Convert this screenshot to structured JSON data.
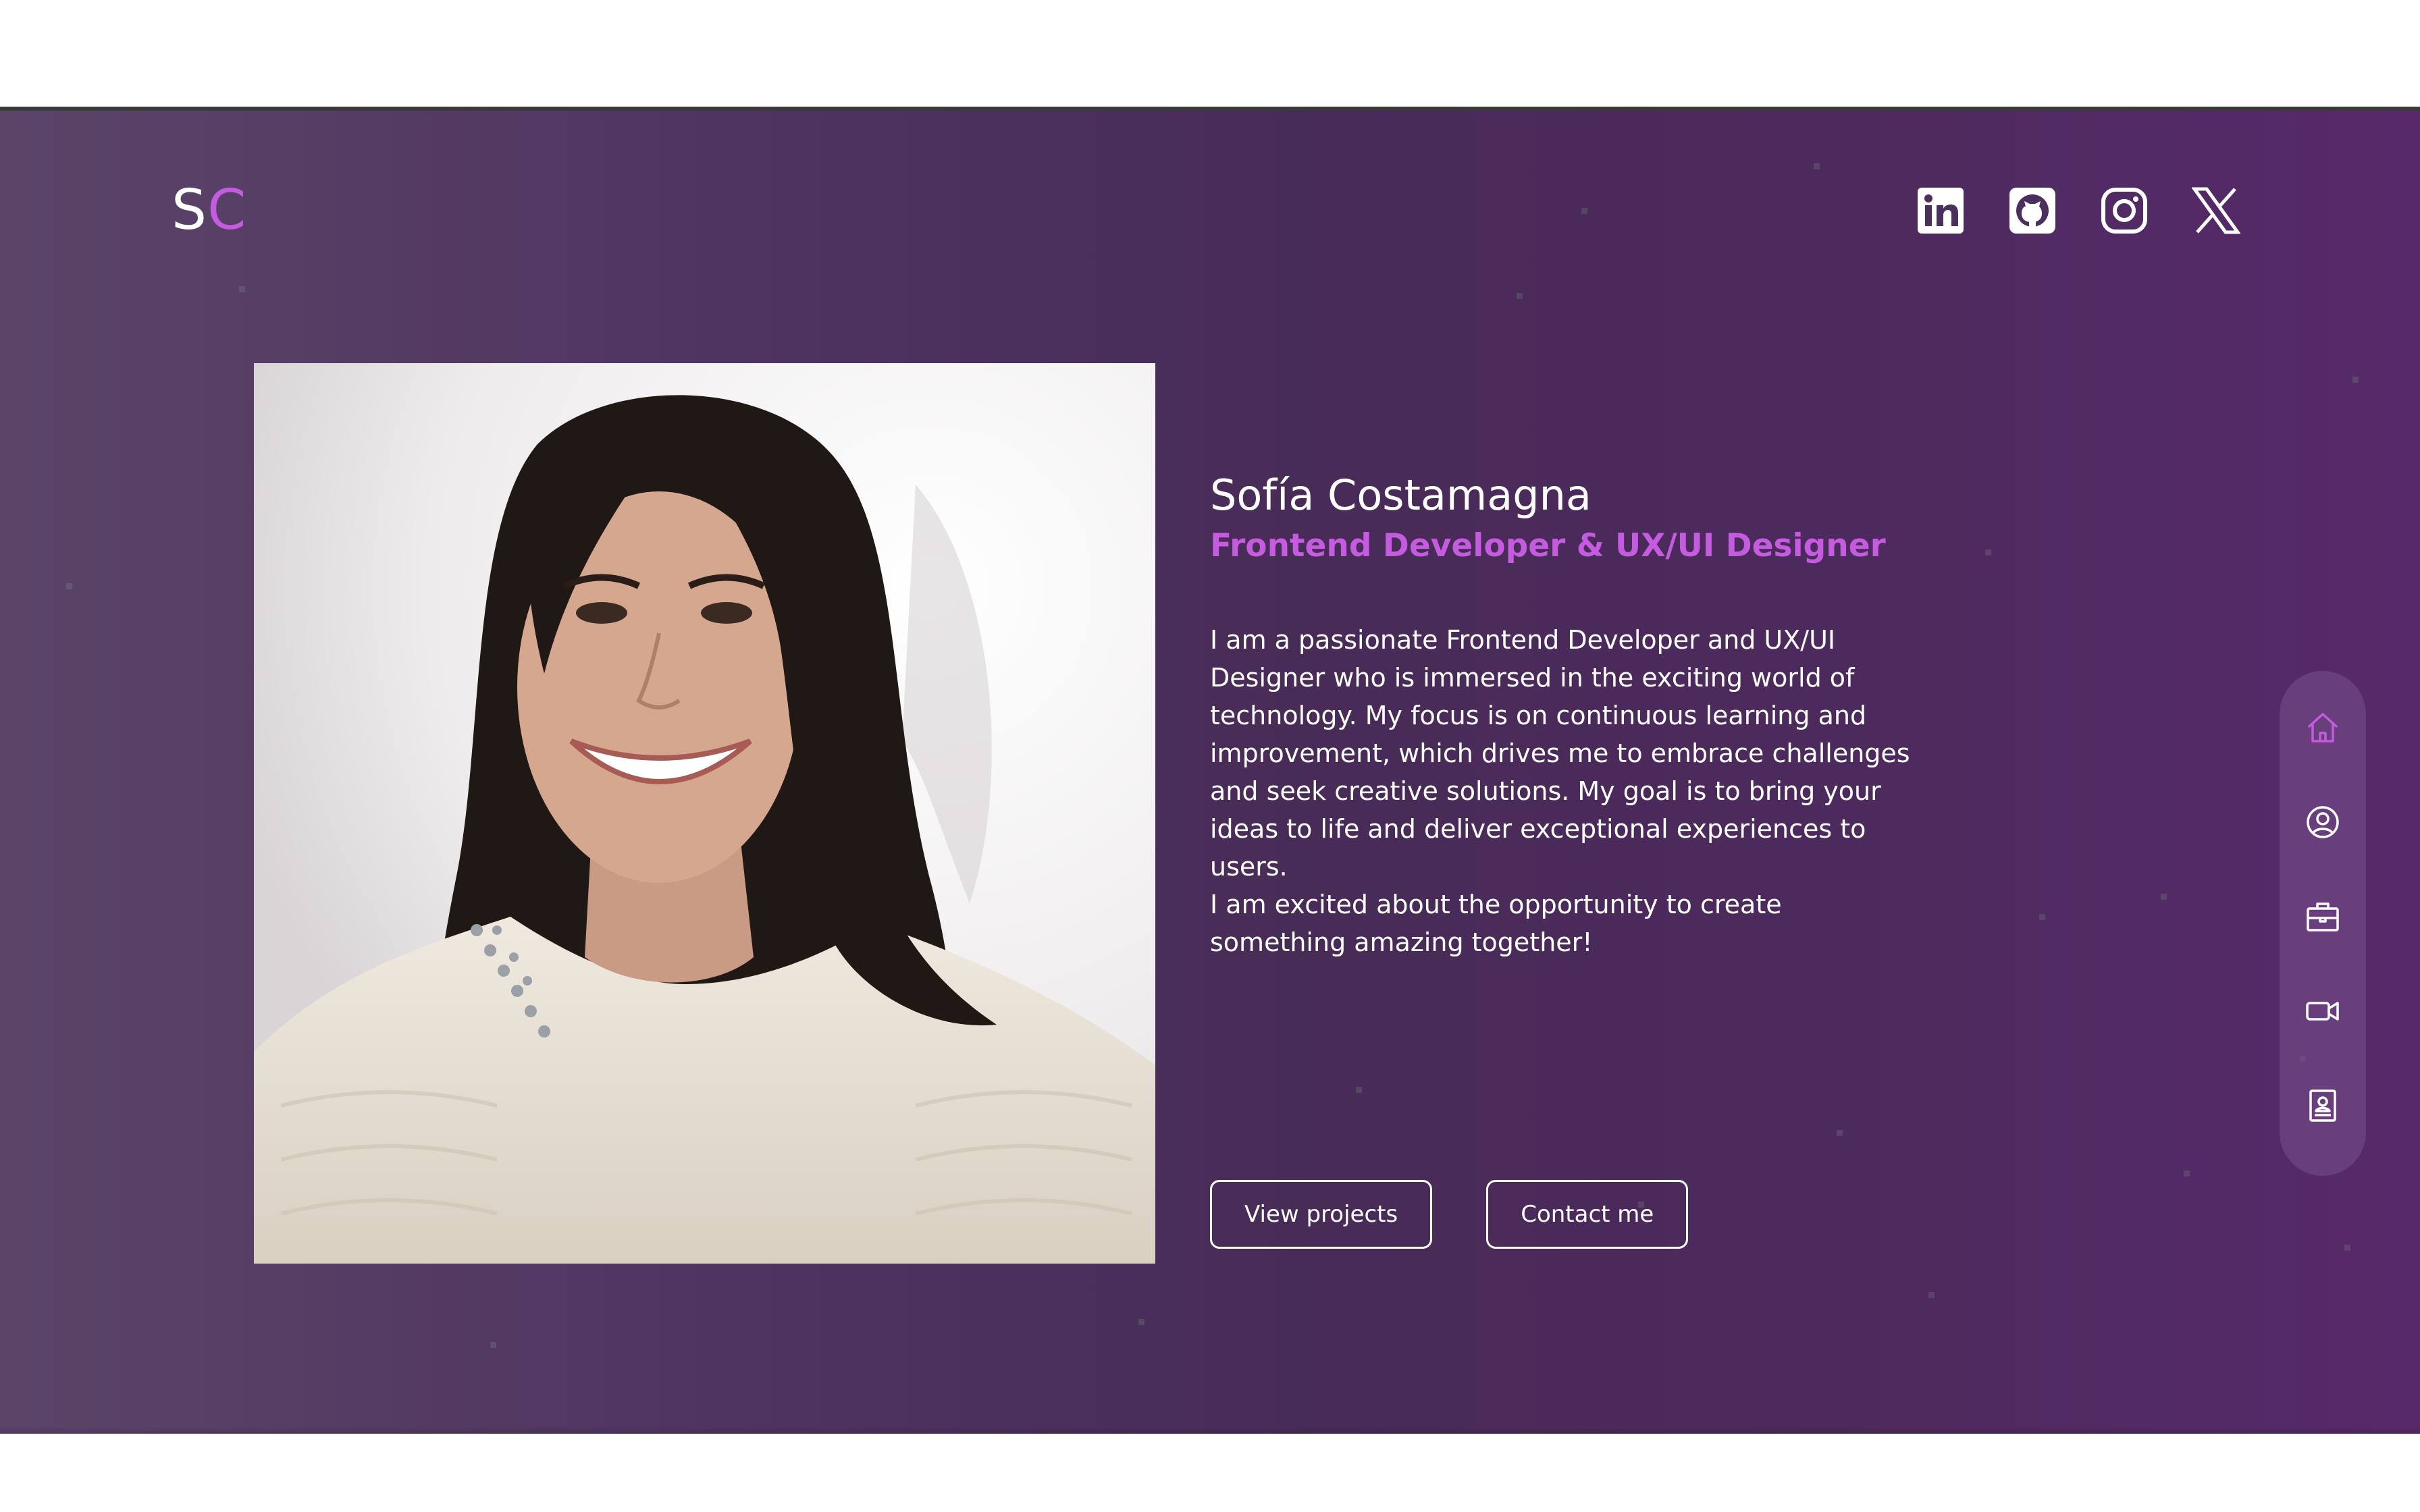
{
  "logo": {
    "first": "S",
    "second": "C"
  },
  "socials": [
    {
      "name": "linkedin-icon",
      "label": "LinkedIn"
    },
    {
      "name": "github-icon",
      "label": "GitHub"
    },
    {
      "name": "instagram-icon",
      "label": "Instagram"
    },
    {
      "name": "x-icon",
      "label": "X"
    }
  ],
  "hero": {
    "name": "Sofía Costamagna",
    "role": "Frontend Developer & UX/UI Designer",
    "bio_1": "I am a passionate Frontend Developer and UX/UI Designer who is immersed in the exciting world of technology. My focus is on continuous learning and improvement, which drives me to embrace challenges and seek creative solutions. My goal is to bring your ideas to life and deliver exceptional experiences to users.",
    "bio_2": "I am excited about the opportunity to create something amazing together!",
    "photo_alt": "Portrait photo"
  },
  "buttons": {
    "projects": "View projects",
    "contact": "Contact me"
  },
  "sidenav": [
    {
      "icon": "home-icon",
      "active": true
    },
    {
      "icon": "user-circle-icon",
      "active": false
    },
    {
      "icon": "briefcase-icon",
      "active": false
    },
    {
      "icon": "video-icon",
      "active": false
    },
    {
      "icon": "contact-card-icon",
      "active": false
    }
  ],
  "colors": {
    "accent": "#c55bde",
    "background": "#4b2f5c",
    "text": "#ffffff"
  }
}
